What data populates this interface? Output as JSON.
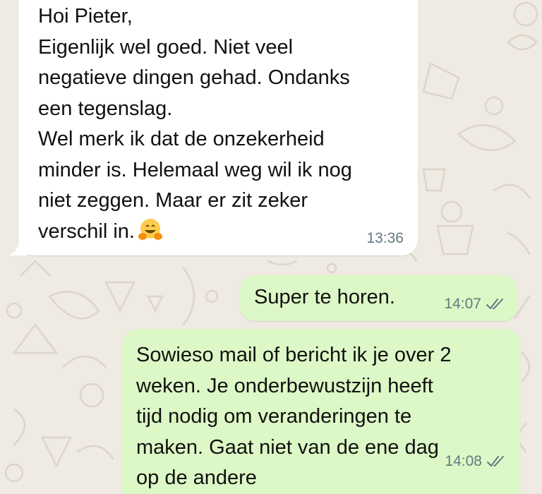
{
  "chat": {
    "messages": [
      {
        "direction": "incoming",
        "text": "Hoi Pieter,\nEigenlijk wel goed. Niet veel\nnegatieve dingen gehad. Ondanks\neen tegenslag.\nWel merk ik dat de onzekerheid\nminder is. Helemaal weg wil ik nog\nniet zeggen. Maar er zit zeker\nverschil in.",
        "emoji": "hugging-face",
        "time": "13:36"
      },
      {
        "direction": "outgoing",
        "text": "Super te horen.",
        "time": "14:07",
        "status": "read"
      },
      {
        "direction": "outgoing",
        "text": "Sowieso mail of bericht ik je over 2\nweken. Je onderbewustzijn heeft\ntijd nodig om veranderingen te\nmaken. Gaat niet van de ene dag\nop de andere",
        "time": "14:08",
        "status": "read"
      }
    ]
  },
  "colors": {
    "wallpaper": "#efeae2",
    "incoming_bubble": "#ffffff",
    "outgoing_bubble": "#dcf8c6",
    "timestamp": "#667781"
  }
}
